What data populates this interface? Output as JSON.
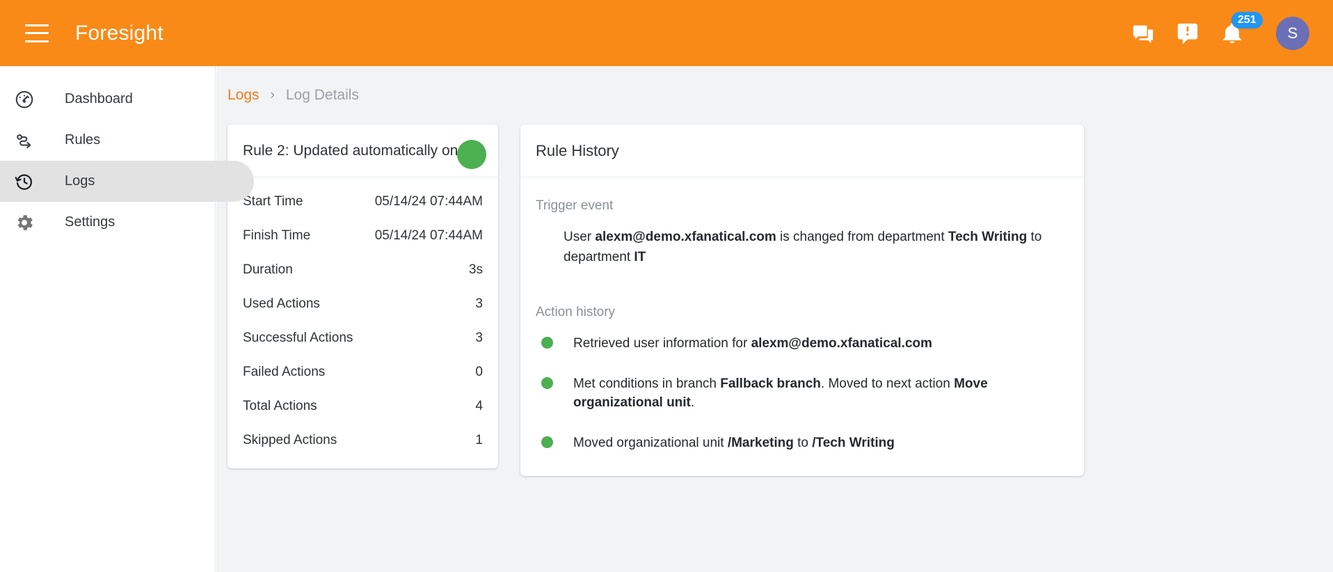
{
  "header": {
    "app_title": "Foresight",
    "menu_icon": "hamburger-menu-icon",
    "chat_icon": "chat-bubbles-icon",
    "feedback_icon": "announcement-icon",
    "notifications_icon": "bell-icon",
    "notification_count": "251",
    "avatar_initial": "S",
    "background_color": "#F98A17",
    "badge_color": "#2196F3",
    "avatar_color": "#6B6FB5"
  },
  "sidebar": {
    "items": [
      {
        "label": "Dashboard",
        "icon": "speedometer-icon",
        "active": false
      },
      {
        "label": "Rules",
        "icon": "route-icon",
        "active": false
      },
      {
        "label": "Logs",
        "icon": "history-clock-icon",
        "active": true
      },
      {
        "label": "Settings",
        "icon": "gear-icon",
        "active": false
      }
    ]
  },
  "breadcrumb": {
    "parent": "Logs",
    "separator": "›",
    "current": "Log Details"
  },
  "log_summary": {
    "rule_title": "Rule 2: Updated automatically on us",
    "status_color": "#4CAF50",
    "rows": [
      {
        "label": "Start Time",
        "value": "05/14/24 07:44AM"
      },
      {
        "label": "Finish Time",
        "value": "05/14/24 07:44AM"
      },
      {
        "label": "Duration",
        "value": "3s"
      },
      {
        "label": "Used Actions",
        "value": "3"
      },
      {
        "label": "Successful Actions",
        "value": "3"
      },
      {
        "label": "Failed Actions",
        "value": "0"
      },
      {
        "label": "Total Actions",
        "value": "4"
      },
      {
        "label": "Skipped Actions",
        "value": "1"
      }
    ]
  },
  "rule_history": {
    "title": "Rule History",
    "trigger_label": "Trigger event",
    "trigger_event": {
      "prefix": "User ",
      "user": "alexm@demo.xfanatical.com",
      "middle": " is changed from department ",
      "from_department": "Tech Writing",
      "middle2": " to department ",
      "to_department": "IT"
    },
    "action_label": "Action history",
    "actions": [
      {
        "status_color": "#4CAF50",
        "segments": [
          {
            "text": "Retrieved user information for ",
            "bold": false
          },
          {
            "text": "alexm@demo.xfanatical.com",
            "bold": true
          }
        ]
      },
      {
        "status_color": "#4CAF50",
        "segments": [
          {
            "text": "Met conditions in branch ",
            "bold": false
          },
          {
            "text": "Fallback branch",
            "bold": true
          },
          {
            "text": ". Moved to next action ",
            "bold": false
          },
          {
            "text": "Move organizational unit",
            "bold": true
          },
          {
            "text": ".",
            "bold": false
          }
        ]
      },
      {
        "status_color": "#4CAF50",
        "segments": [
          {
            "text": "Moved organizational unit ",
            "bold": false
          },
          {
            "text": "/Marketing",
            "bold": true
          },
          {
            "text": " to ",
            "bold": false
          },
          {
            "text": "/Tech Writing",
            "bold": true
          }
        ]
      }
    ]
  }
}
